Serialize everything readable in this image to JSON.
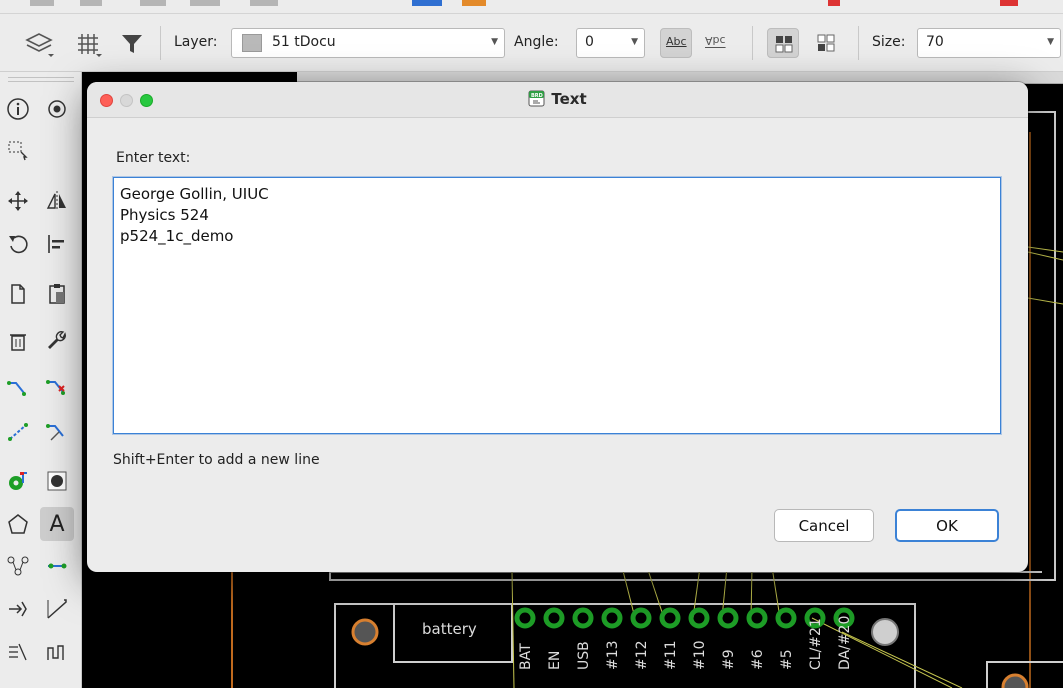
{
  "toolbar": {
    "layer_label": "Layer:",
    "layer_value": "51 tDocu",
    "layer_swatch_color": "#b9b9b9",
    "angle_label": "Angle:",
    "angle_value": "0",
    "abc_label": "Abc",
    "mirrored_label": "Abc",
    "size_label": "Size:",
    "size_value": "70"
  },
  "dialog": {
    "title": "Text",
    "title_icon": "brd-file-icon",
    "prompt": "Enter text:",
    "text_value": "George Gollin, UIUC\nPhysics 524\np524_1c_demo",
    "hint": "Shift+Enter to add a new line",
    "cancel_label": "Cancel",
    "ok_label": "OK"
  },
  "board": {
    "battery_label": "battery",
    "pin_labels": [
      "BAT",
      "EN",
      "USB",
      "#13",
      "#12",
      "#11",
      "#10",
      "#9",
      "#6",
      "#5",
      "CL/#21",
      "DA/#20"
    ]
  },
  "colors": {
    "accent": "#3b82d6",
    "close": "#fe5f57",
    "zoom": "#28c840",
    "pad_green": "#1e9e27",
    "trace_yellow": "#c8c850"
  }
}
